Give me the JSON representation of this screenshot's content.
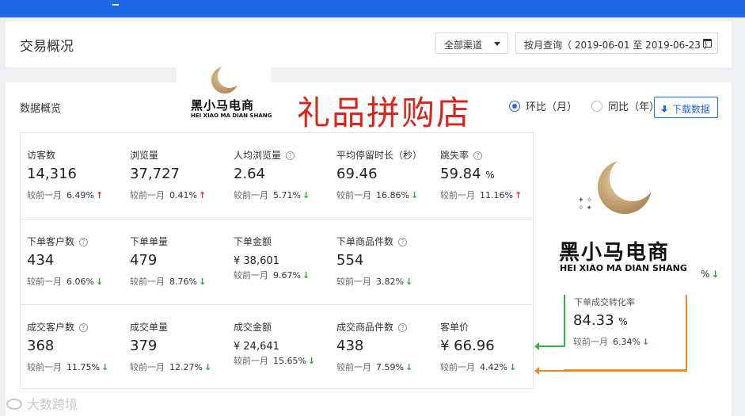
{
  "header": {
    "title": "交易概况",
    "channel_select": "全部渠道",
    "date_range": "按月查询（ 2019-06-01 至 2019-06-23 ）"
  },
  "overview": {
    "title": "数据概览",
    "shop_name": "礼品拼购店",
    "radio_options": [
      {
        "label": "环比（月）",
        "checked": true
      },
      {
        "label": "同比（年）",
        "checked": false
      }
    ],
    "download_label": "下载数据"
  },
  "brand_watermark": {
    "name_cn": "黑小马电商",
    "name_en": "HEI XIAO MA DIAN SHANG"
  },
  "compare_label": "较前一月",
  "metrics": [
    [
      {
        "label": "访客数",
        "value": "14,316",
        "unit": "",
        "pct": "6.49%",
        "trend": "up",
        "help": false
      },
      {
        "label": "浏览量",
        "value": "37,727",
        "unit": "",
        "pct": "0.41%",
        "trend": "up",
        "help": false
      },
      {
        "label": "人均浏览量",
        "value": "2.64",
        "unit": "",
        "pct": "5.71%",
        "trend": "down",
        "help": true
      },
      {
        "label": "平均停留时长（秒）",
        "value": "69.46",
        "unit": "",
        "pct": "16.86%",
        "trend": "down",
        "help": false
      },
      {
        "label": "跳失率",
        "value": "59.84",
        "unit": "%",
        "pct": "11.16%",
        "trend": "up",
        "help": true
      }
    ],
    [
      {
        "label": "下单客户数",
        "value": "434",
        "unit": "",
        "pct": "6.06%",
        "trend": "down",
        "help": true
      },
      {
        "label": "下单单量",
        "value": "479",
        "unit": "",
        "pct": "8.76%",
        "trend": "down",
        "help": false
      },
      {
        "label": "下单金额",
        "value": "¥ 38,601",
        "unit": "",
        "pct": "9.67%",
        "trend": "down",
        "help": false,
        "small": true
      },
      {
        "label": "下单商品件数",
        "value": "554",
        "unit": "",
        "pct": "3.82%",
        "trend": "down",
        "help": true
      }
    ],
    [
      {
        "label": "成交客户数",
        "value": "368",
        "unit": "",
        "pct": "11.75%",
        "trend": "down",
        "help": true
      },
      {
        "label": "成交单量",
        "value": "379",
        "unit": "",
        "pct": "12.27%",
        "trend": "down",
        "help": false
      },
      {
        "label": "成交金额",
        "value": "¥ 24,641",
        "unit": "",
        "pct": "15.65%",
        "trend": "down",
        "help": false,
        "small": true
      },
      {
        "label": "成交商品件数",
        "value": "438",
        "unit": "",
        "pct": "7.59%",
        "trend": "down",
        "help": true
      },
      {
        "label": "客单价",
        "value": "¥ 66.96",
        "unit": "",
        "pct": "4.42%",
        "trend": "down",
        "help": false
      }
    ]
  ],
  "right_partial_pct": "%",
  "conversion": {
    "label_partial": "下单成交转化率",
    "value": "84.33",
    "unit": "%",
    "compare_label": "较前一月",
    "pct": "6.34%",
    "trend": "down"
  },
  "watermark": "大数跨境",
  "colors": {
    "primary": "#1f68e6",
    "up": "#e03030",
    "down": "#2aa33a",
    "shop_name": "#d8261c",
    "orange_line": "#f08a24"
  }
}
